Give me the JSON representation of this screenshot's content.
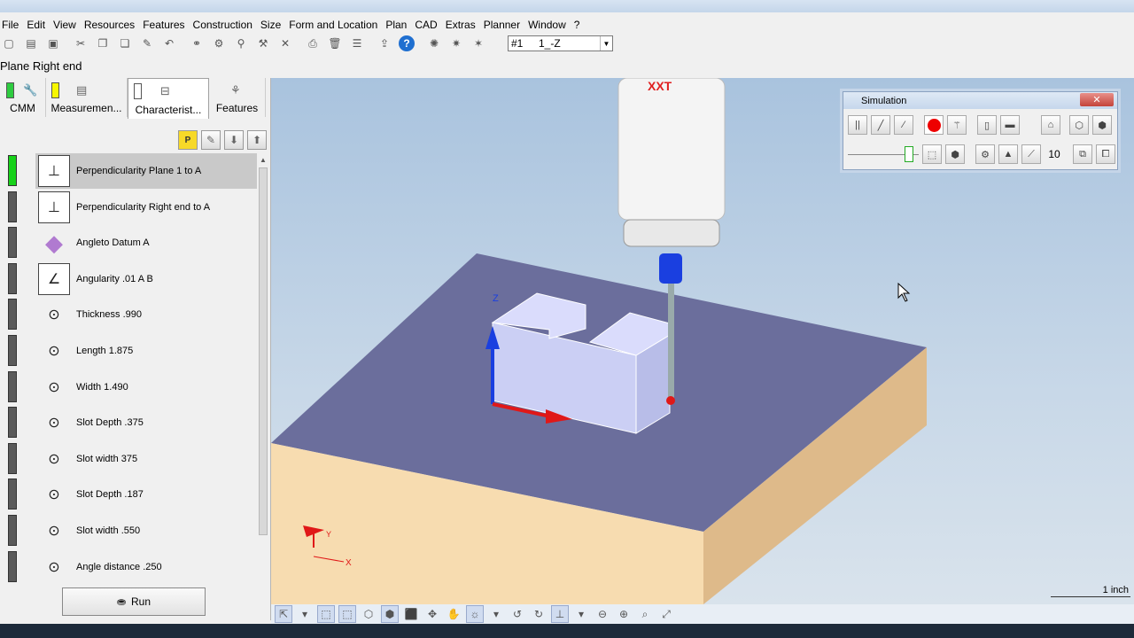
{
  "menubar": [
    "File",
    "Edit",
    "View",
    "Resources",
    "Features",
    "Construction",
    "Size",
    "Form and Location",
    "Plan",
    "CAD",
    "Extras",
    "Planner",
    "Window",
    "?"
  ],
  "toolbar": {
    "probe_number": "#1",
    "probe_name": "1_-Z"
  },
  "context_title": "Plane  Right end",
  "tabs": [
    {
      "label": "CMM",
      "flag": "#2ecc40"
    },
    {
      "label": "Measuremen...",
      "flag": "#f7f700"
    },
    {
      "label": "Characterist...",
      "flag": "#ffffff",
      "active": true
    },
    {
      "label": "Features"
    }
  ],
  "characteristics": [
    {
      "label": "Perpendicularity Plane 1 to A",
      "icon": "perpendicularity-icon",
      "status": "green",
      "selected": true
    },
    {
      "label": "Perpendicularity Right end to A",
      "icon": "perpendicularity-icon",
      "status": "gray"
    },
    {
      "label": "Angleto Datum A",
      "icon": "angle-icon",
      "status": "gray"
    },
    {
      "label": "Angularity .01 A B",
      "icon": "angularity-icon",
      "status": "gray"
    },
    {
      "label": "Thickness .990",
      "icon": "distance-icon",
      "status": "gray"
    },
    {
      "label": "Length 1.875",
      "icon": "distance-icon",
      "status": "gray"
    },
    {
      "label": "Width 1.490",
      "icon": "distance-icon",
      "status": "gray"
    },
    {
      "label": "Slot Depth .375",
      "icon": "distance-icon",
      "status": "gray"
    },
    {
      "label": "Slot width 375",
      "icon": "distance-icon",
      "status": "gray"
    },
    {
      "label": "Slot Depth .187",
      "icon": "distance-icon",
      "status": "gray"
    },
    {
      "label": "Slot width .550",
      "icon": "distance-icon",
      "status": "gray"
    },
    {
      "label": "Angle distance .250",
      "icon": "distance-icon",
      "status": "gray"
    }
  ],
  "run_button": "Run",
  "viewport": {
    "probe_brand": "XXT",
    "axis_z": "Z",
    "axis_x": "X",
    "axis_y": "Y",
    "scale_label": "1 inch"
  },
  "simulation": {
    "title": "Simulation",
    "speed": "10"
  },
  "colors": {
    "table_top": "#6b6e9c",
    "table_front": "#f7dcb0",
    "table_side": "#deba8a",
    "part": "#ccd0f4",
    "axis_z": "#1a3fe0",
    "axis_x": "#e01818",
    "status_green": "#17d21a"
  }
}
